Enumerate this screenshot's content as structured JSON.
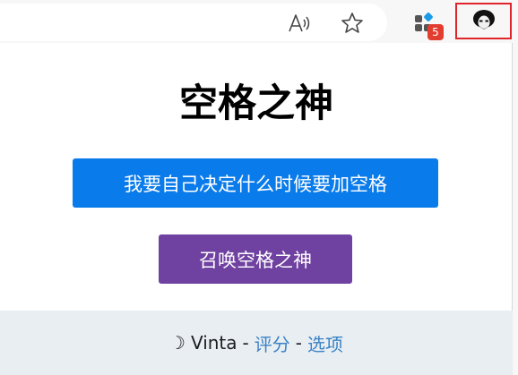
{
  "toolbar": {
    "read_aloud_icon": "read-aloud-icon",
    "favorite_icon": "star-icon",
    "extensions_icon": "extensions-icon",
    "extensions_badge": "5",
    "space_god_icon": "space-god-avatar-icon"
  },
  "popup": {
    "title": "空格之神",
    "decide_button": "我要自己决定什么时候要加空格",
    "summon_button": "召唤空格之神",
    "footer": {
      "logo_glyph": "☽",
      "author": "Vinta",
      "separator": "-",
      "rate_link": "评分",
      "options_link": "选项"
    }
  },
  "colors": {
    "decide_button_bg": "#0a7bea",
    "summon_button_bg": "#6f41a0",
    "footer_bg": "#e9eef3",
    "link": "#3a82c4",
    "badge": "#e23d2e",
    "highlight_border": "#e0242b"
  }
}
